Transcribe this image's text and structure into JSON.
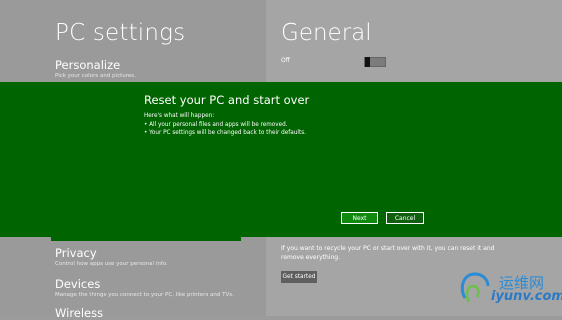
{
  "settings": {
    "page_title": "PC settings",
    "section_title": "General",
    "toggle_value": "Off",
    "nav": [
      {
        "label": "Personalize",
        "description": "Pick your colors and pictures."
      },
      {
        "label": "Privacy",
        "description": "Control how apps use your personal info."
      },
      {
        "label": "Devices",
        "description": "Manage the things you connect to your PC, like printers and TVs."
      },
      {
        "label": "Wireless",
        "description": ""
      }
    ],
    "reset_text": "If you want to recycle your PC or start over with it, you can reset it and remove everything.",
    "get_started_label": "Get started"
  },
  "dialog": {
    "title": "Reset your PC and start over",
    "intro": "Here's what will happen:",
    "bullets": [
      "• All your personal files and apps will be removed.",
      "• Your PC settings will be changed back to their defaults."
    ],
    "next_label": "Next",
    "cancel_label": "Cancel"
  },
  "watermark": {
    "cn": "运维网",
    "en": "iyunv.com"
  },
  "colors": {
    "dialog_green": "#006400",
    "background_gray": "#9d9d9d"
  }
}
